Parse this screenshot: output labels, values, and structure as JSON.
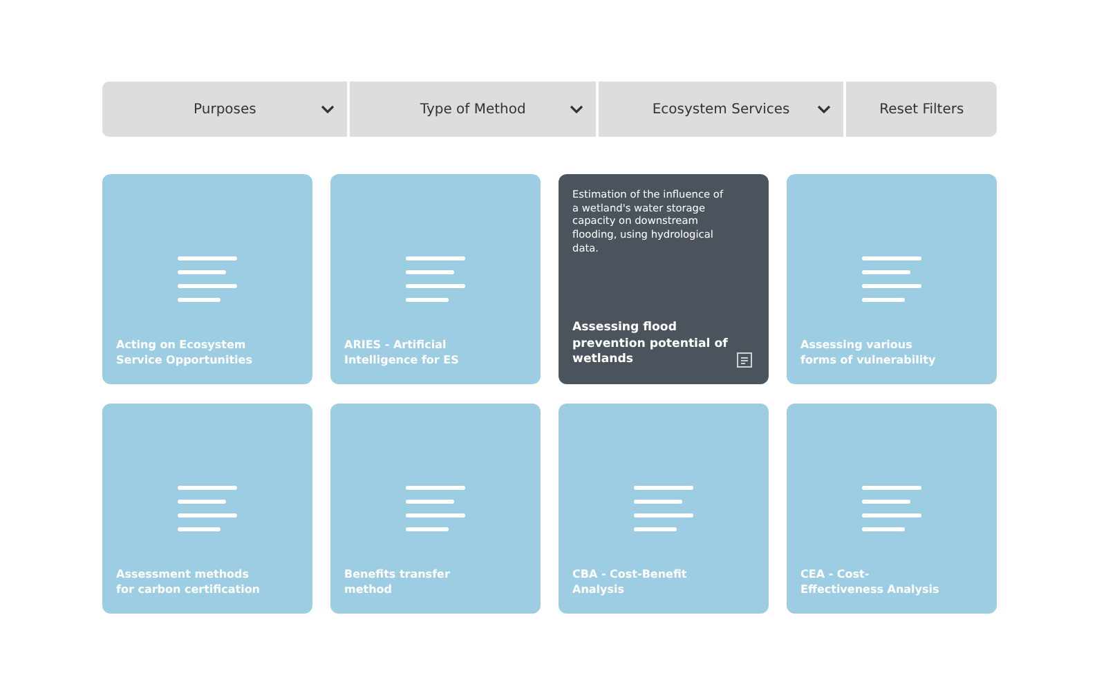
{
  "filters": [
    {
      "kind": "dropdown",
      "label": "Purposes"
    },
    {
      "kind": "dropdown",
      "label": "Type of Method"
    },
    {
      "kind": "dropdown",
      "label": "Ecosystem Services"
    },
    {
      "kind": "reset",
      "label": "Reset Filters"
    }
  ],
  "cards": [
    {
      "title": "Acting on Ecosystem\nService Opportunities",
      "hovered": false
    },
    {
      "title": "ARIES - Artificial\nIntelligence for ES",
      "hovered": false
    },
    {
      "title": "Assessing flood\nprevention potential of\nwetlands",
      "hovered": true,
      "description": "Estimation of the influence of a wetland's water storage capacity on downstream flooding, using hydrological data."
    },
    {
      "title": "Assessing various\nforms of vulnerability",
      "hovered": false
    },
    {
      "title": "Assessment methods\nfor carbon certification",
      "hovered": false
    },
    {
      "title": "Benefits transfer\nmethod",
      "hovered": false
    },
    {
      "title": "CBA - Cost-Benefit\nAnalysis",
      "hovered": false
    },
    {
      "title": "CEA - Cost-\nEffectiveness Analysis",
      "hovered": false
    }
  ]
}
